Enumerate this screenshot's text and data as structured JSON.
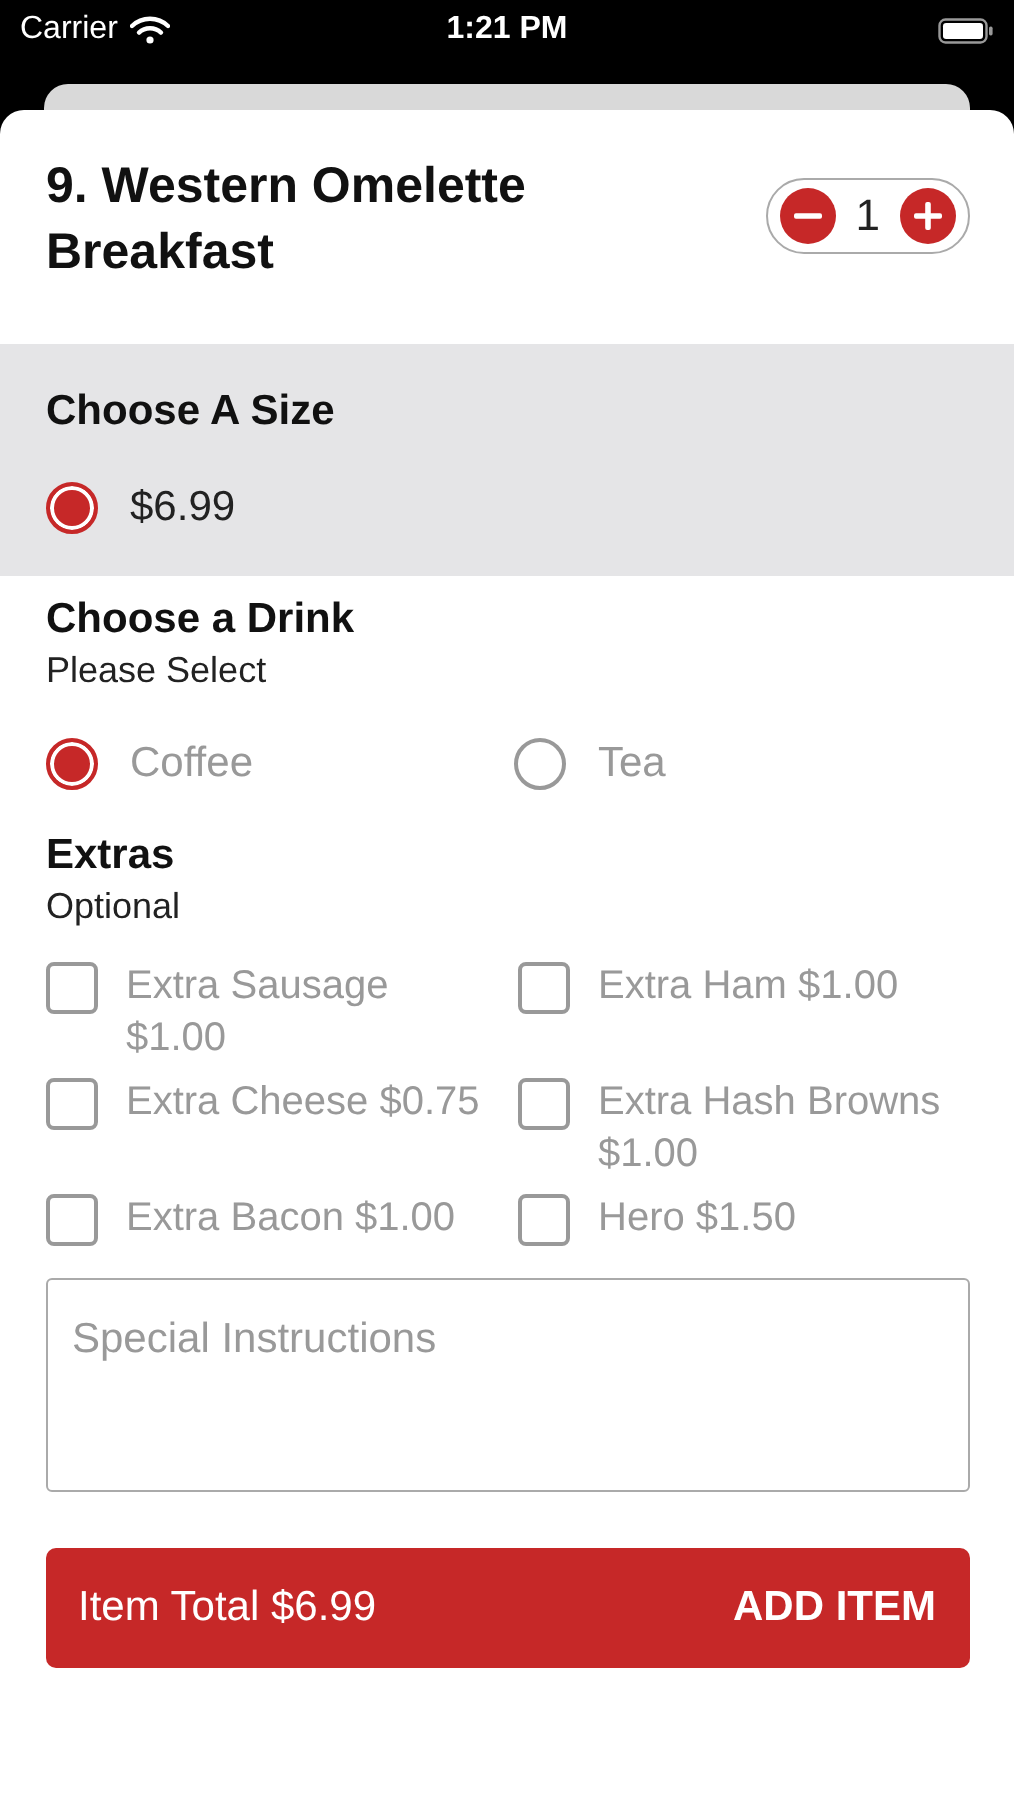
{
  "status_bar": {
    "carrier": "Carrier",
    "time": "1:21 PM"
  },
  "item": {
    "title": "9. Western Omelette Breakfast",
    "quantity": "1"
  },
  "size_group": {
    "title": "Choose A Size",
    "options": [
      {
        "label": "$6.99",
        "selected": true
      }
    ]
  },
  "drink_group": {
    "title": "Choose a Drink",
    "subtitle": "Please Select",
    "options": [
      {
        "label": "Coffee",
        "selected": true
      },
      {
        "label": "Tea",
        "selected": false
      }
    ]
  },
  "extras_group": {
    "title": "Extras",
    "subtitle": "Optional",
    "options": [
      {
        "label": "Extra Sausage $1.00",
        "checked": false
      },
      {
        "label": "Extra Ham $1.00",
        "checked": false
      },
      {
        "label": "Extra Cheese $0.75",
        "checked": false
      },
      {
        "label": "Extra Hash Browns $1.00",
        "checked": false
      },
      {
        "label": "Extra Bacon $1.00",
        "checked": false
      },
      {
        "label": "Hero $1.50",
        "checked": false
      }
    ]
  },
  "special_instructions": {
    "placeholder": "Special Instructions"
  },
  "add_bar": {
    "total": "Item Total $6.99",
    "button": "ADD ITEM"
  }
}
